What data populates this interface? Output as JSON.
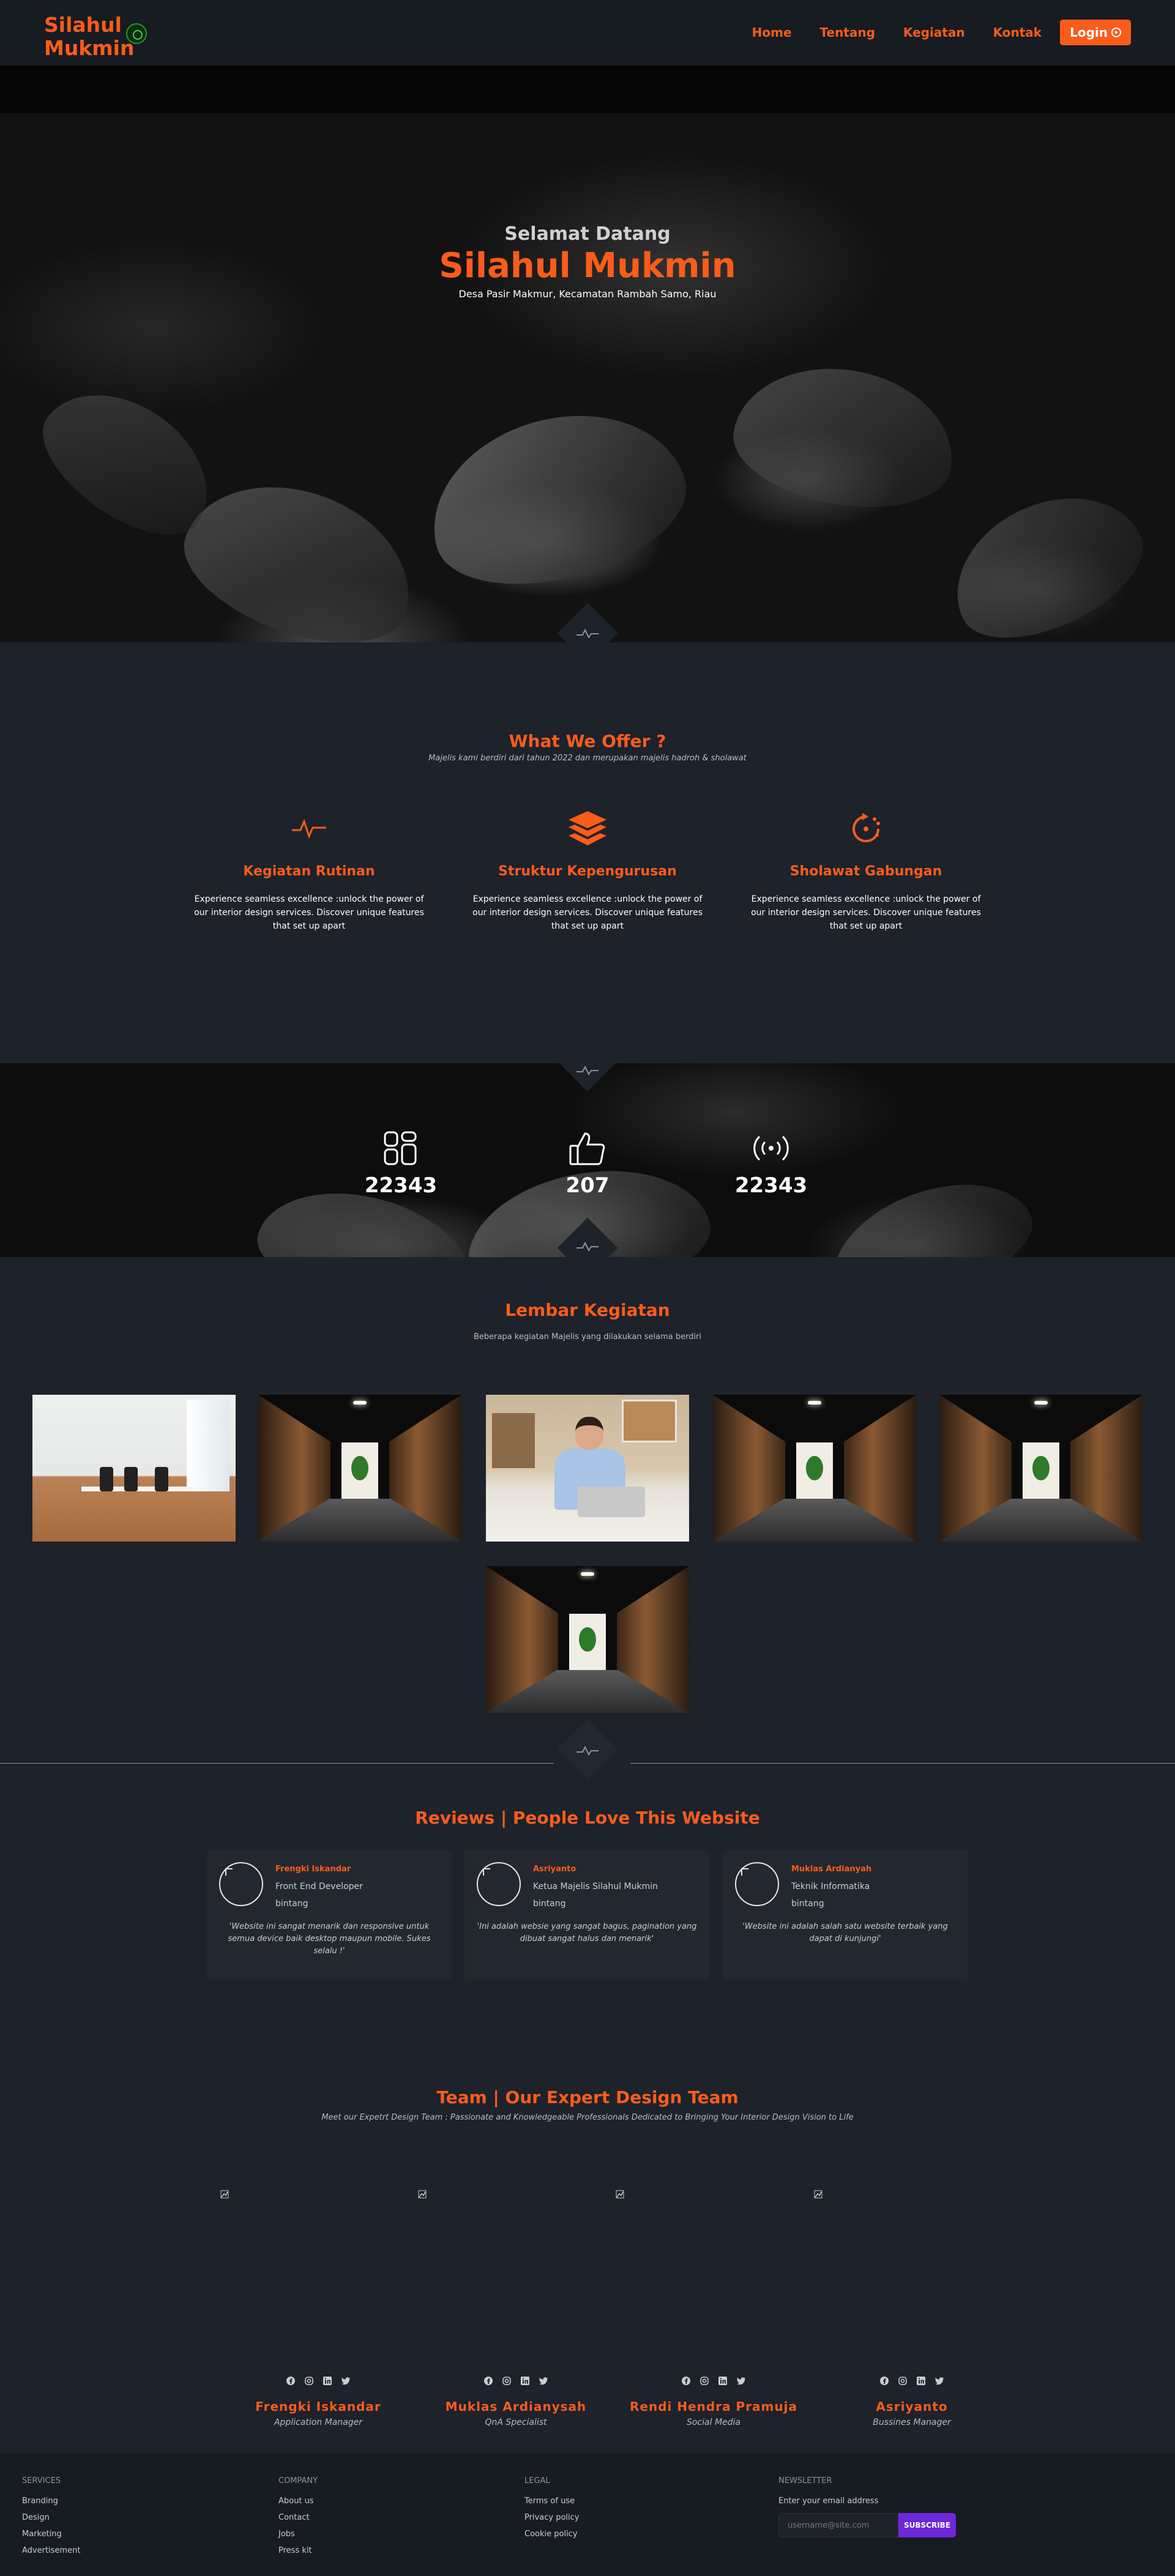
{
  "nav": {
    "brand": "Silahul Mukmin",
    "links": [
      "Home",
      "Tentang",
      "Kegiatan",
      "Kontak"
    ],
    "login": "Login"
  },
  "hero": {
    "welcome": "Selamat Datang",
    "title": "Silahul Mukmin",
    "subtitle": "Desa Pasir Makmur, Kecamatan Rambah Samo, Riau"
  },
  "offer": {
    "title": "What We Offer ?",
    "subtitle": "Majelis kami berdiri dari tahun 2022 dan merupakan majelis hadroh & sholawat",
    "features": [
      {
        "icon": "pulse-icon",
        "title": "Kegiatan Rutinan",
        "desc": "Experience seamless excellence :unlock the power of our interior design services. Discover unique features that set up apart"
      },
      {
        "icon": "layers-icon",
        "title": "Struktur Kepengurusan",
        "desc": "Experience seamless excellence :unlock the power of our interior design services. Discover unique features that set up apart"
      },
      {
        "icon": "refresh-dots-icon",
        "title": "Sholawat Gabungan",
        "desc": "Experience seamless excellence :unlock the power of our interior design services. Discover unique features that set up apart"
      }
    ]
  },
  "stats": [
    {
      "icon": "grid-icon",
      "value": "22343"
    },
    {
      "icon": "thumbs-up-icon",
      "value": "207"
    },
    {
      "icon": "broadcast-icon",
      "value": "22343"
    }
  ],
  "gallery": {
    "title": "Lembar Kegiatan",
    "subtitle": "Beberapa kegiatan Majelis yang dilakukan selama berdiri"
  },
  "reviews": {
    "title": "Reviews | People Love This Website",
    "items": [
      {
        "name": "Frengki Iskandar",
        "role": "Front End Developer",
        "rating": "bintang",
        "text": "'Website ini sangat menarik dan responsive untuk semua device baik desktop maupun mobile. Sukes selalu !'"
      },
      {
        "name": "Asriyanto",
        "role": "Ketua Majelis Silahul Mukmin",
        "rating": "bintang",
        "text": "'Ini adalah websie yang sangat bagus, pagination yang dibuat sangat halus dan menarik'"
      },
      {
        "name": "Muklas Ardianyah",
        "role": "Teknik Informatika",
        "rating": "bintang",
        "text": "'Website ini adalah salah satu website terbaik yang dapat di kunjungi'"
      }
    ]
  },
  "team": {
    "title": "Team | Our Expert Design Team",
    "subtitle": "Meet our Expetrt Design Team : Passionate and Knowledgeable Professionals Dedicated to Bringing Your Interior Design Vision to Life",
    "members": [
      {
        "name": "Frengki Iskandar",
        "role": "Application Manager"
      },
      {
        "name": "Muklas Ardianysah",
        "role": "QnA Specialist"
      },
      {
        "name": "Rendi Hendra Pramuja",
        "role": "Social Media"
      },
      {
        "name": "Asriyanto",
        "role": "Bussines Manager"
      }
    ]
  },
  "footer": {
    "services": {
      "title": "Services",
      "links": [
        "Branding",
        "Design",
        "Marketing",
        "Advertisement"
      ]
    },
    "company": {
      "title": "Company",
      "links": [
        "About us",
        "Contact",
        "Jobs",
        "Press kit"
      ]
    },
    "legal": {
      "title": "Legal",
      "links": [
        "Terms of use",
        "Privacy policy",
        "Cookie policy"
      ]
    },
    "newsletter": {
      "title": "Newsletter",
      "label": "Enter your email address",
      "placeholder": "username@site.com",
      "button": "SUBSCRIBE"
    }
  },
  "colors": {
    "accent": "#fa5c1b",
    "background": "#1d222b",
    "subscribe": "#6d28d9"
  }
}
